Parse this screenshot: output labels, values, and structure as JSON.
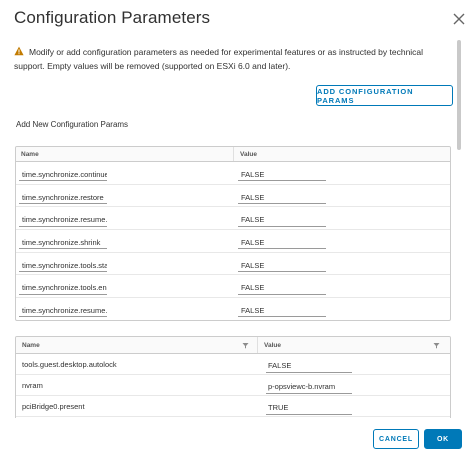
{
  "dialog": {
    "title": "Configuration Parameters",
    "warning_text": "Modify or add configuration parameters as needed for experimental features or as instructed by technical support. Empty values will be removed (supported on ESXi 6.0 and later).",
    "add_button": "ADD CONFIGURATION PARAMS",
    "new_params_label": "Add New Configuration Params",
    "cancel": "CANCEL",
    "ok": "OK"
  },
  "new_params": {
    "headers": {
      "name": "Name",
      "value": "Value"
    },
    "rows": [
      {
        "name": "time.synchronize.continue",
        "value": "FALSE"
      },
      {
        "name": "time.synchronize.restore",
        "value": "FALSE"
      },
      {
        "name": "time.synchronize.resume.disk",
        "value": "FALSE"
      },
      {
        "name": "time.synchronize.shrink",
        "value": "FALSE"
      },
      {
        "name": "time.synchronize.tools.startup",
        "value": "FALSE"
      },
      {
        "name": "time.synchronize.tools.enable",
        "value": "FALSE"
      },
      {
        "name": "time.synchronize.resume.host",
        "value": "FALSE"
      }
    ]
  },
  "existing_params": {
    "headers": {
      "name": "Name",
      "value": "Value"
    },
    "rows": [
      {
        "name": "tools.guest.desktop.autolock",
        "value": "FALSE"
      },
      {
        "name": "nvram",
        "value": "p-opsviewc-b.nvram"
      },
      {
        "name": "pciBridge0.present",
        "value": "TRUE"
      }
    ]
  },
  "colors": {
    "accent": "#0079b8",
    "warning": "#c27b00"
  },
  "icons": {
    "close": "close-icon",
    "warning": "warning-icon",
    "filter": "filter-icon"
  }
}
